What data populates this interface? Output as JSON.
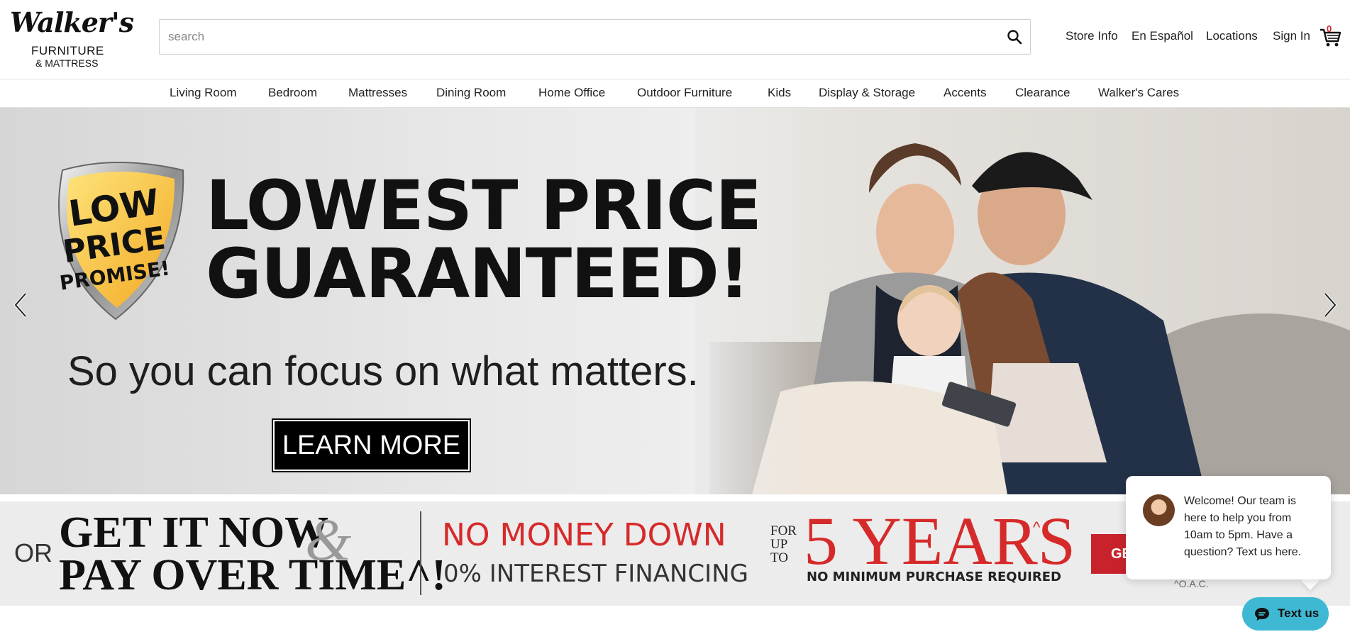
{
  "logo": {
    "line1": "Walker's",
    "line2": "FURNITURE",
    "line3": "& MATTRESS"
  },
  "search": {
    "placeholder": "search",
    "value": ""
  },
  "header_links": [
    "Store Info",
    "En Español",
    "Locations",
    "Sign In"
  ],
  "cart": {
    "count": "0",
    "icon": "cart-icon"
  },
  "nav": [
    "Living Room",
    "Bedroom",
    "Mattresses",
    "Dining Room",
    "Home Office",
    "Outdoor Furniture",
    "Kids",
    "Display & Storage",
    "Accents",
    "Clearance",
    "Walker's Cares"
  ],
  "hero": {
    "badge_line1": "LOW",
    "badge_line2": "PRICE",
    "badge_line3": "PROMISE!",
    "headline_line1": "LOWEST PRICE",
    "headline_line2": "GUARANTEED!",
    "subline": "So you can focus on what matters.",
    "cta": "LEARN MORE"
  },
  "promo": {
    "or": "OR",
    "getit_line1": "GET IT NOW",
    "amp": "&",
    "getit_line2": "PAY OVER TIME^!",
    "no_money": "NO MONEY DOWN",
    "interest": "0% INTEREST FINANCING",
    "for_up_to_1": "FOR",
    "for_up_to_2": "UP",
    "for_up_to_3": "TO",
    "years": "5 YEARS",
    "caret": "^",
    "no_minimum": "NO MINIMUM PURCHASE REQUIRED",
    "button": "GE",
    "oac": "^O.A.C."
  },
  "chat": {
    "message": "Welcome! Our team is here to help you from 10am to 5pm. Have a question? Text us here.",
    "button": "Text us"
  },
  "colors": {
    "accent_red": "#d62a2a",
    "chat_blue": "#3fb9d3",
    "badge_yellow": "#f6c22c"
  }
}
